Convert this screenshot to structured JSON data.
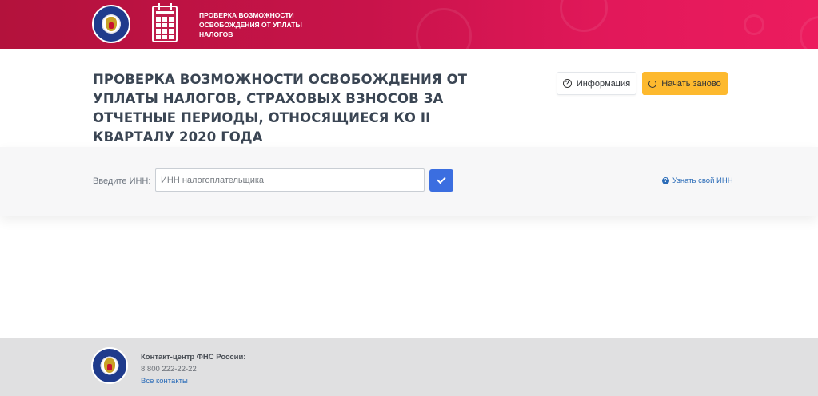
{
  "header": {
    "title": "ПРОВЕРКА ВОЗМОЖНОСТИ ОСВОБОЖДЕНИЯ ОТ УПЛАТЫ НАЛОГОВ",
    "logo_icon": "fns-emblem-icon",
    "calendar_icon": "calendar-icon",
    "colors": {
      "start": "#b3123c",
      "end": "#ec1c5e"
    }
  },
  "main": {
    "title": "ПРОВЕРКА ВОЗМОЖНОСТИ ОСВОБОЖДЕНИЯ ОТ УПЛАТЫ НАЛОГОВ, СТРАХОВЫХ ВЗНОСОВ ЗА ОТЧЕТНЫЕ ПЕРИОДЫ, ОТНОСЯЩИЕСЯ КО II КВАРТАЛУ 2020 ГОДА",
    "info_button": {
      "label": "Информация",
      "icon": "question-circle-icon"
    },
    "restart_button": {
      "label": "Начать заново",
      "icon": "refresh-icon",
      "color": "#fdb92e"
    }
  },
  "search": {
    "label": "Введите ИНН:",
    "input_value": "",
    "placeholder": "ИНН налогоплательщика",
    "submit_icon": "check-icon",
    "submit_color": "#3b6ee0",
    "find_inn_link": "Узнать свой ИНН"
  },
  "footer": {
    "contact_title": "Контакт-центр ФНС России:",
    "phone": "8 800 222-22-22",
    "all_contacts": "Все контакты"
  }
}
